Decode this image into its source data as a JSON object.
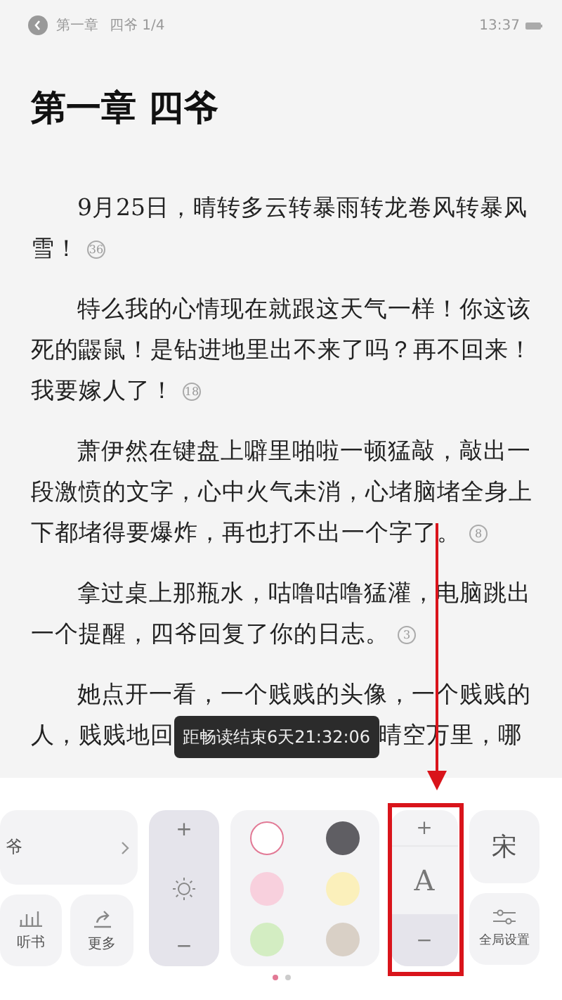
{
  "header": {
    "chapter": "第一章",
    "progress": "四爷 1/4",
    "time": "13:37"
  },
  "title": "第一章 四爷",
  "paragraphs": [
    {
      "text": "9月25日，晴转多云转暴雨转龙卷风转暴风雪！",
      "note": "36"
    },
    {
      "text": "特么我的心情现在就跟这天气一样！你这该死的鼹鼠！是钻进地里出不来了吗？再不回来！我要嫁人了！",
      "note": "18"
    },
    {
      "text": "萧伊然在键盘上噼里啪啦一顿猛敲，敲出一段激愤的文字，心中火气未消，心堵脑堵全身上下都堵得要爆炸，再也打不出一个字了。",
      "note": "8"
    },
    {
      "text": "拿过桌上那瓶水，咕噜咕噜猛灌，电脑跳出一个提醒，四爷回复了你的日志。",
      "note": "3"
    },
    {
      "text": "她点开一看，一个贱贱的头像，一个贱贱的人，贱贱地回",
      "after": "晴空万里，哪"
    }
  ],
  "toast": "距畅读结束6天21:32:06",
  "panel": {
    "catalog": "爷",
    "listen": "听书",
    "more": "更多",
    "brightness": {
      "plus": "+",
      "minus": "−"
    },
    "colors": [
      {
        "color": "#ffffff",
        "selected": true
      },
      {
        "color": "#5f5e63",
        "selected": false
      },
      {
        "color": "#f8d0dd",
        "selected": false
      },
      {
        "color": "#fbf0bb",
        "selected": false
      },
      {
        "color": "#d3edc2",
        "selected": false
      },
      {
        "color": "#d9d0c6",
        "selected": false
      }
    ],
    "font_size": {
      "plus": "+",
      "label": "A",
      "minus": "−"
    },
    "font": "宋",
    "settings": "全局设置"
  },
  "pages": [
    {
      "selected": true
    },
    {
      "selected": false
    }
  ]
}
